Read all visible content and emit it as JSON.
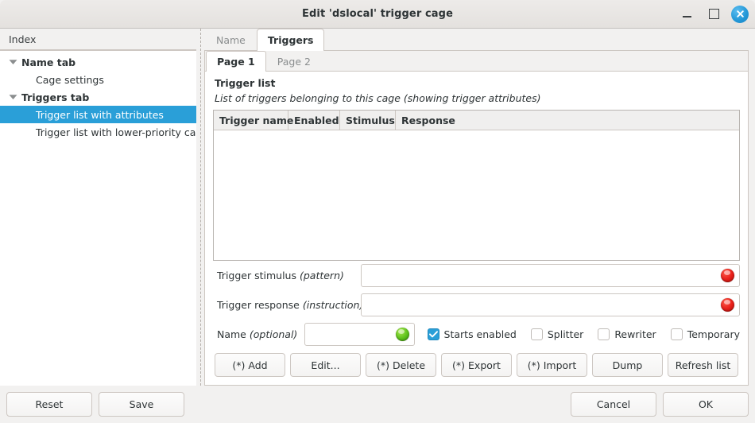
{
  "titlebar": {
    "title": "Edit 'dslocal' trigger cage",
    "minimize_label": "Minimize",
    "maximize_label": "Maximize",
    "close_label": "Close"
  },
  "sidebar": {
    "header": "Index",
    "items": [
      {
        "label": "Name tab",
        "type": "parent",
        "expanded": true,
        "selected": false
      },
      {
        "label": "Cage settings",
        "type": "child",
        "selected": false
      },
      {
        "label": "Triggers tab",
        "type": "parent",
        "expanded": true,
        "selected": false
      },
      {
        "label": "Trigger list with attributes",
        "type": "child",
        "selected": true
      },
      {
        "label": "Trigger list with lower-priority cage",
        "type": "child",
        "selected": false
      }
    ]
  },
  "tabs_outer": [
    {
      "label": "Name",
      "active": false
    },
    {
      "label": "Triggers",
      "active": true
    }
  ],
  "tabs_inner": [
    {
      "label": "Page 1",
      "active": true
    },
    {
      "label": "Page 2",
      "active": false
    }
  ],
  "main": {
    "section_title": "Trigger list",
    "section_desc": "List of triggers belonging to this cage (showing trigger attributes)",
    "table": {
      "columns": [
        "Trigger name",
        "Enabled",
        "Stimulus",
        "Response"
      ],
      "rows": []
    },
    "fields": {
      "stimulus": {
        "label_main": "Trigger stimulus",
        "label_italic": "(pattern)",
        "value": "",
        "placeholder": "",
        "led": "red"
      },
      "response": {
        "label_main": "Trigger response",
        "label_italic": "(instruction)",
        "value": "",
        "placeholder": "",
        "led": "red"
      },
      "name": {
        "label_main": "Name",
        "label_italic": "(optional)",
        "value": "",
        "placeholder": "",
        "led": "green"
      }
    },
    "checkboxes": [
      {
        "label": "Starts enabled",
        "checked": true
      },
      {
        "label": "Splitter",
        "checked": false
      },
      {
        "label": "Rewriter",
        "checked": false
      },
      {
        "label": "Temporary",
        "checked": false
      }
    ],
    "buttons": [
      "(*) Add",
      "Edit...",
      "(*) Delete",
      "(*) Export",
      "(*) Import",
      "Dump",
      "Refresh list"
    ]
  },
  "actionbar": {
    "reset": "Reset",
    "save": "Save",
    "cancel": "Cancel",
    "ok": "OK"
  },
  "colors": {
    "selection": "#2a9fd8",
    "close_button": "#2196d6",
    "led_red": "#e8201a",
    "led_green": "#5cc11a",
    "window_bg": "#f2f1f0"
  }
}
